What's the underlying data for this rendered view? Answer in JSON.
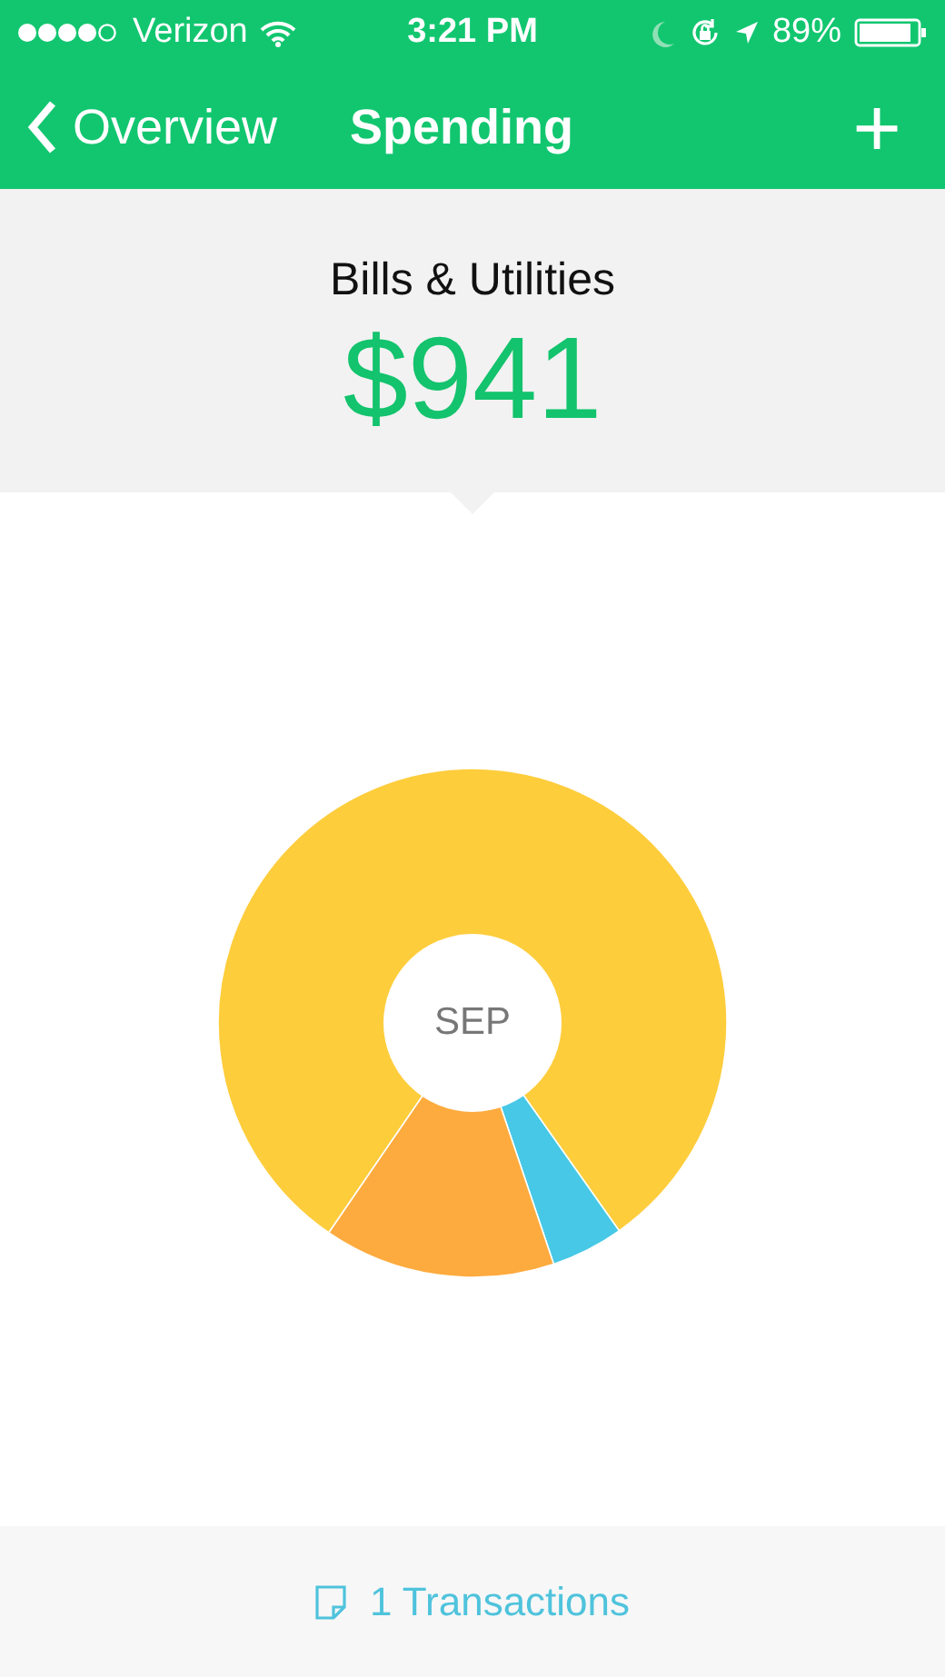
{
  "status_bar": {
    "carrier": "Verizon",
    "time": "3:21 PM",
    "battery": "89%"
  },
  "nav": {
    "back": "Overview",
    "title": "Spending",
    "add": "+"
  },
  "header": {
    "category": "Bills & Utilities",
    "amount": "$941"
  },
  "chart": {
    "center_label": "SEP"
  },
  "footer": {
    "transactions": "1 Transactions"
  }
}
